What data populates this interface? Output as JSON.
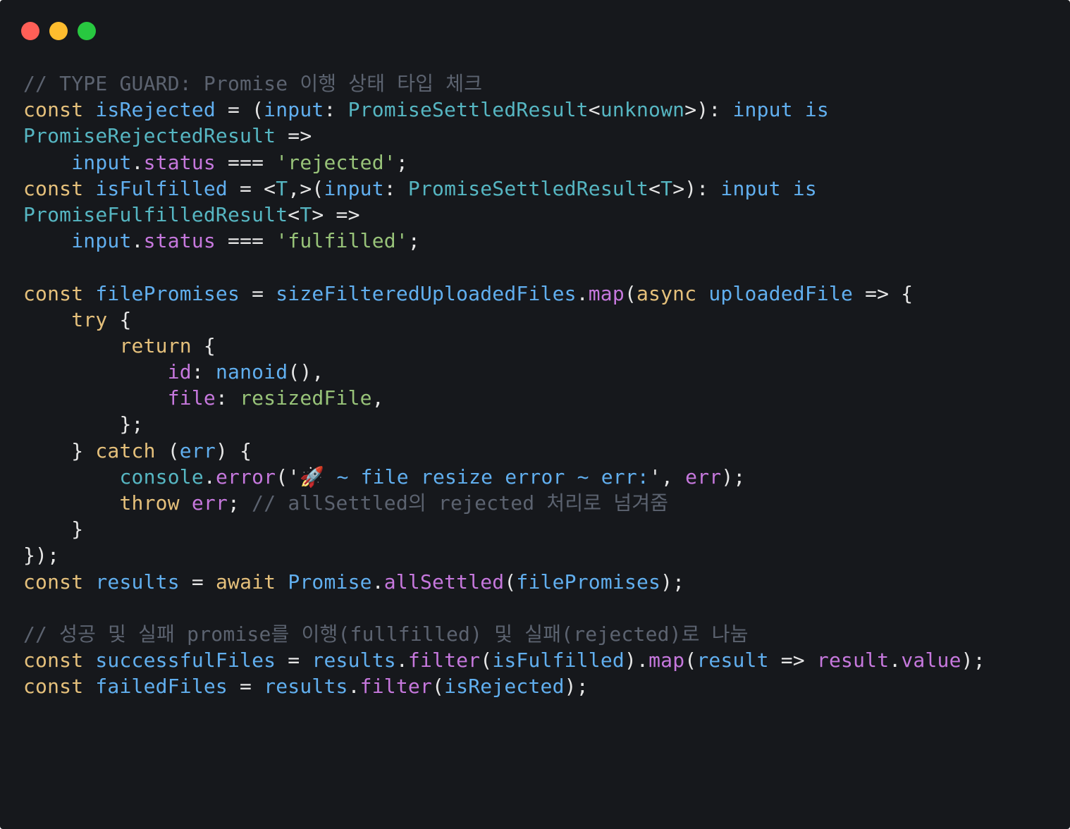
{
  "window": {
    "background": "#16181c",
    "controls": [
      {
        "name": "close",
        "color": "#ff5f57"
      },
      {
        "name": "minimize",
        "color": "#febc2e"
      },
      {
        "name": "maximize",
        "color": "#28c840"
      }
    ]
  },
  "palette": {
    "comment": "#5c6370",
    "keyword": "#e5c07b",
    "identifier": "#61afef",
    "type": "#56b6c2",
    "property": "#c678dd",
    "string": "#98c379",
    "punct": "#e6e6e6"
  },
  "code": {
    "lines": [
      [
        {
          "t": "// TYPE GUARD: Promise 이행 상태 타입 체크",
          "c": "comment"
        }
      ],
      [
        {
          "t": "const",
          "c": "keyword"
        },
        {
          "t": " ",
          "c": "punct"
        },
        {
          "t": "isRejected",
          "c": "identifier"
        },
        {
          "t": " = (",
          "c": "punct"
        },
        {
          "t": "input",
          "c": "identifier"
        },
        {
          "t": ": ",
          "c": "punct"
        },
        {
          "t": "PromiseSettledResult",
          "c": "type"
        },
        {
          "t": "<",
          "c": "punct"
        },
        {
          "t": "unknown",
          "c": "type"
        },
        {
          "t": ">): ",
          "c": "punct"
        },
        {
          "t": "input",
          "c": "identifier"
        },
        {
          "t": " ",
          "c": "punct"
        },
        {
          "t": "is",
          "c": "identifier"
        }
      ],
      [
        {
          "t": "PromiseRejectedResult",
          "c": "type"
        },
        {
          "t": " =>",
          "c": "punct"
        }
      ],
      [
        {
          "t": "    ",
          "c": "punct"
        },
        {
          "t": "input",
          "c": "identifier"
        },
        {
          "t": ".",
          "c": "punct"
        },
        {
          "t": "status",
          "c": "property"
        },
        {
          "t": " === ",
          "c": "punct"
        },
        {
          "t": "'rejected'",
          "c": "string"
        },
        {
          "t": ";",
          "c": "punct"
        }
      ],
      [
        {
          "t": "const",
          "c": "keyword"
        },
        {
          "t": " ",
          "c": "punct"
        },
        {
          "t": "isFulfilled",
          "c": "identifier"
        },
        {
          "t": " = <",
          "c": "punct"
        },
        {
          "t": "T",
          "c": "type"
        },
        {
          "t": ",>(",
          "c": "punct"
        },
        {
          "t": "input",
          "c": "identifier"
        },
        {
          "t": ": ",
          "c": "punct"
        },
        {
          "t": "PromiseSettledResult",
          "c": "type"
        },
        {
          "t": "<",
          "c": "punct"
        },
        {
          "t": "T",
          "c": "type"
        },
        {
          "t": ">): ",
          "c": "punct"
        },
        {
          "t": "input",
          "c": "identifier"
        },
        {
          "t": " ",
          "c": "punct"
        },
        {
          "t": "is",
          "c": "identifier"
        }
      ],
      [
        {
          "t": "PromiseFulfilledResult",
          "c": "type"
        },
        {
          "t": "<",
          "c": "punct"
        },
        {
          "t": "T",
          "c": "type"
        },
        {
          "t": "> =>",
          "c": "punct"
        }
      ],
      [
        {
          "t": "    ",
          "c": "punct"
        },
        {
          "t": "input",
          "c": "identifier"
        },
        {
          "t": ".",
          "c": "punct"
        },
        {
          "t": "status",
          "c": "property"
        },
        {
          "t": " === ",
          "c": "punct"
        },
        {
          "t": "'fulfilled'",
          "c": "string"
        },
        {
          "t": ";",
          "c": "punct"
        }
      ],
      [
        {
          "t": "",
          "c": "punct"
        }
      ],
      [
        {
          "t": "const",
          "c": "keyword"
        },
        {
          "t": " ",
          "c": "punct"
        },
        {
          "t": "filePromises",
          "c": "identifier"
        },
        {
          "t": " = ",
          "c": "punct"
        },
        {
          "t": "sizeFilteredUploadedFiles",
          "c": "identifier"
        },
        {
          "t": ".",
          "c": "punct"
        },
        {
          "t": "map",
          "c": "property"
        },
        {
          "t": "(",
          "c": "punct"
        },
        {
          "t": "async",
          "c": "keyword"
        },
        {
          "t": " ",
          "c": "punct"
        },
        {
          "t": "uploadedFile",
          "c": "identifier"
        },
        {
          "t": " => {",
          "c": "punct"
        }
      ],
      [
        {
          "t": "    ",
          "c": "punct"
        },
        {
          "t": "try",
          "c": "keyword"
        },
        {
          "t": " {",
          "c": "punct"
        }
      ],
      [
        {
          "t": "        ",
          "c": "punct"
        },
        {
          "t": "return",
          "c": "keyword"
        },
        {
          "t": " {",
          "c": "punct"
        }
      ],
      [
        {
          "t": "            ",
          "c": "punct"
        },
        {
          "t": "id",
          "c": "property"
        },
        {
          "t": ": ",
          "c": "punct"
        },
        {
          "t": "nanoid",
          "c": "identifier"
        },
        {
          "t": "(),",
          "c": "punct"
        }
      ],
      [
        {
          "t": "            ",
          "c": "punct"
        },
        {
          "t": "file",
          "c": "property"
        },
        {
          "t": ": ",
          "c": "punct"
        },
        {
          "t": "resizedFile",
          "c": "string"
        },
        {
          "t": ",",
          "c": "punct"
        }
      ],
      [
        {
          "t": "        };",
          "c": "punct"
        }
      ],
      [
        {
          "t": "    } ",
          "c": "punct"
        },
        {
          "t": "catch",
          "c": "keyword"
        },
        {
          "t": " (",
          "c": "punct"
        },
        {
          "t": "err",
          "c": "identifier"
        },
        {
          "t": ") {",
          "c": "punct"
        }
      ],
      [
        {
          "t": "        ",
          "c": "punct"
        },
        {
          "t": "console",
          "c": "type"
        },
        {
          "t": ".",
          "c": "punct"
        },
        {
          "t": "error",
          "c": "property"
        },
        {
          "t": "('",
          "c": "punct"
        },
        {
          "t": "🚀 ~ file resize error ~ err:",
          "c": "identifier"
        },
        {
          "t": "', ",
          "c": "punct"
        },
        {
          "t": "err",
          "c": "property"
        },
        {
          "t": ");",
          "c": "punct"
        }
      ],
      [
        {
          "t": "        ",
          "c": "punct"
        },
        {
          "t": "throw",
          "c": "keyword"
        },
        {
          "t": " ",
          "c": "punct"
        },
        {
          "t": "err",
          "c": "property"
        },
        {
          "t": "; ",
          "c": "punct"
        },
        {
          "t": "// allSettled의 rejected 처리로 넘겨줌",
          "c": "comment"
        }
      ],
      [
        {
          "t": "    }",
          "c": "punct"
        }
      ],
      [
        {
          "t": "});",
          "c": "punct"
        }
      ],
      [
        {
          "t": "const",
          "c": "keyword"
        },
        {
          "t": " ",
          "c": "punct"
        },
        {
          "t": "results",
          "c": "identifier"
        },
        {
          "t": " = ",
          "c": "punct"
        },
        {
          "t": "await",
          "c": "keyword"
        },
        {
          "t": " ",
          "c": "punct"
        },
        {
          "t": "Promise",
          "c": "identifier"
        },
        {
          "t": ".",
          "c": "punct"
        },
        {
          "t": "allSettled",
          "c": "property"
        },
        {
          "t": "(",
          "c": "punct"
        },
        {
          "t": "filePromises",
          "c": "identifier"
        },
        {
          "t": ");",
          "c": "punct"
        }
      ],
      [
        {
          "t": "",
          "c": "punct"
        }
      ],
      [
        {
          "t": "// 성공 및 실패 promise를 이행(fullfilled) 및 실패(rejected)로 나눔",
          "c": "comment"
        }
      ],
      [
        {
          "t": "const",
          "c": "keyword"
        },
        {
          "t": " ",
          "c": "punct"
        },
        {
          "t": "successfulFiles",
          "c": "identifier"
        },
        {
          "t": " = ",
          "c": "punct"
        },
        {
          "t": "results",
          "c": "identifier"
        },
        {
          "t": ".",
          "c": "punct"
        },
        {
          "t": "filter",
          "c": "property"
        },
        {
          "t": "(",
          "c": "punct"
        },
        {
          "t": "isFulfilled",
          "c": "identifier"
        },
        {
          "t": ").",
          "c": "punct"
        },
        {
          "t": "map",
          "c": "property"
        },
        {
          "t": "(",
          "c": "punct"
        },
        {
          "t": "result",
          "c": "identifier"
        },
        {
          "t": " => ",
          "c": "punct"
        },
        {
          "t": "result",
          "c": "property"
        },
        {
          "t": ".",
          "c": "punct"
        },
        {
          "t": "value",
          "c": "property"
        },
        {
          "t": ");",
          "c": "punct"
        }
      ],
      [
        {
          "t": "const",
          "c": "keyword"
        },
        {
          "t": " ",
          "c": "punct"
        },
        {
          "t": "failedFiles",
          "c": "identifier"
        },
        {
          "t": " = ",
          "c": "punct"
        },
        {
          "t": "results",
          "c": "identifier"
        },
        {
          "t": ".",
          "c": "punct"
        },
        {
          "t": "filter",
          "c": "property"
        },
        {
          "t": "(",
          "c": "punct"
        },
        {
          "t": "isRejected",
          "c": "identifier"
        },
        {
          "t": ");",
          "c": "punct"
        }
      ]
    ]
  }
}
